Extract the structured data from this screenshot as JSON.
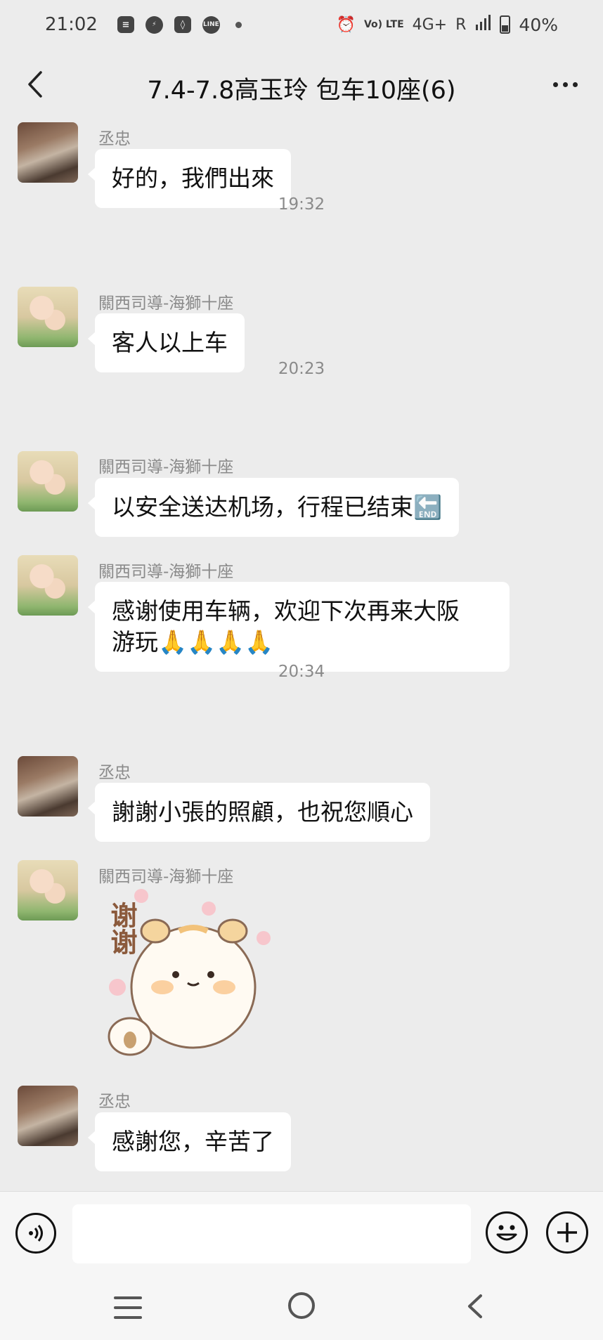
{
  "status_bar": {
    "time": "21:02",
    "left_icons": [
      "message-icon",
      "messenger-icon",
      "app-icon",
      "line-icon",
      "dot-icon"
    ],
    "line_label": "LINE",
    "volte_label": "Vo) LTE",
    "network": "4G+",
    "roaming": "R",
    "battery_percent": "40%"
  },
  "header": {
    "title": "7.4-7.8高玉玲 包车10座(6)"
  },
  "messages": [
    {
      "sender": "丞忠",
      "text": "好的，我們出來",
      "avatar": "avatar-a"
    },
    {
      "timestamp": "19:32"
    },
    {
      "sender": "關西司導-海獅十座",
      "text": "客人以上车",
      "avatar": "avatar-b"
    },
    {
      "timestamp": "20:23"
    },
    {
      "sender": "關西司導-海獅十座",
      "text": "以安全送达机场，行程已结束🔚",
      "avatar": "avatar-b"
    },
    {
      "sender": "關西司導-海獅十座",
      "text_line1": "感谢使用车辆，欢迎下次再来大阪",
      "text_line2": "游玩",
      "text_emoji": "🙏🙏🙏🙏",
      "avatar": "avatar-b"
    },
    {
      "timestamp": "20:34"
    },
    {
      "sender": "丞忠",
      "text": "謝謝小張的照顧，也祝您順心",
      "avatar": "avatar-a"
    },
    {
      "sender": "關西司導-海獅十座",
      "sticker_text": "谢谢",
      "avatar": "avatar-b"
    },
    {
      "sender": "丞忠",
      "text": "感謝您，辛苦了",
      "avatar": "avatar-a"
    }
  ],
  "input_bar": {
    "placeholder": "",
    "value": ""
  },
  "colors": {
    "background": "#ececec",
    "bubble": "#ffffff",
    "meta_text": "#8a8a8a"
  }
}
